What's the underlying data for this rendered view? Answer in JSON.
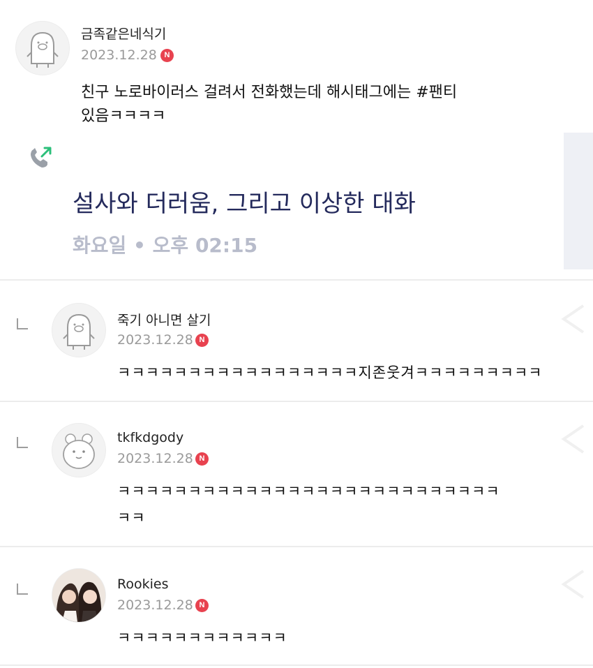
{
  "post": {
    "username": "금족같은네식기",
    "date": "2023.12.28",
    "badge": "N",
    "text_line1": "친구 노로바이러스 걸려서 전화했는데 해시태그에는 #팬티",
    "text_line2": "있음ㅋㅋㅋㅋ"
  },
  "call_card": {
    "title": "설사와 더러움, 그리고 이상한 대화",
    "time": "화요일 • 오후 02:15",
    "icon": "phone-outgoing-icon"
  },
  "replies": [
    {
      "username": "죽기 아니면 살기",
      "date": "2023.12.28",
      "badge": "N",
      "text_line1": "ㅋㅋㅋㅋㅋㅋㅋㅋㅋㅋㅋㅋㅋㅋㅋㅋㅋ지존웃겨ㅋㅋㅋㅋㅋㅋㅋㅋㅋ",
      "text_line2": ""
    },
    {
      "username": "tkfkdgody",
      "date": "2023.12.28",
      "badge": "N",
      "text_line1": "ㅋㅋㅋㅋㅋㅋㅋㅋㅋㅋㅋㅋㅋㅋㅋㅋㅋㅋㅋㅋㅋㅋㅋㅋㅋㅋㅋ",
      "text_line2": "ㅋㅋ"
    },
    {
      "username": "Rookies",
      "date": "2023.12.28",
      "badge": "N",
      "text_line1": "ㅋㅋㅋㅋㅋㅋㅋㅋㅋㅋㅋㅋ",
      "text_line2": ""
    }
  ],
  "colors": {
    "badge": "#e8424f",
    "call_title": "#242a5c",
    "call_time": "#b8bccb",
    "date": "#9a9a9a"
  }
}
